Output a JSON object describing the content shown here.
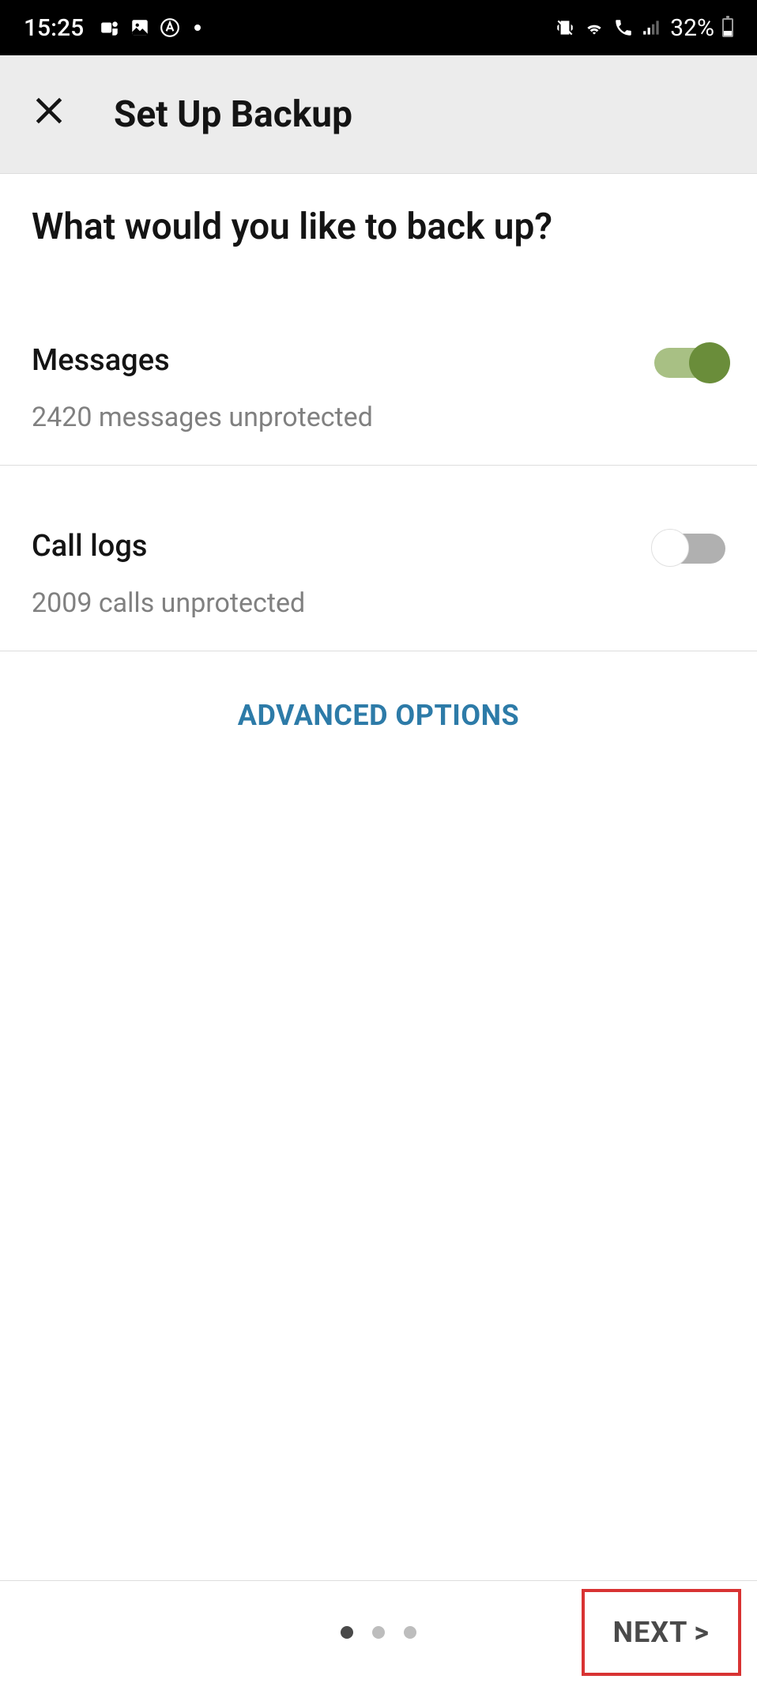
{
  "status_bar": {
    "time": "15:25",
    "battery": "32%"
  },
  "header": {
    "title": "Set Up Backup"
  },
  "main": {
    "question": "What would you like to back up?",
    "options": [
      {
        "title": "Messages",
        "subtitle": "2420 messages unprotected",
        "enabled": true
      },
      {
        "title": "Call logs",
        "subtitle": "2009 calls unprotected",
        "enabled": false
      }
    ],
    "advanced": "ADVANCED OPTIONS"
  },
  "footer": {
    "current_page": 1,
    "total_pages": 3,
    "next_label": "NEXT"
  }
}
